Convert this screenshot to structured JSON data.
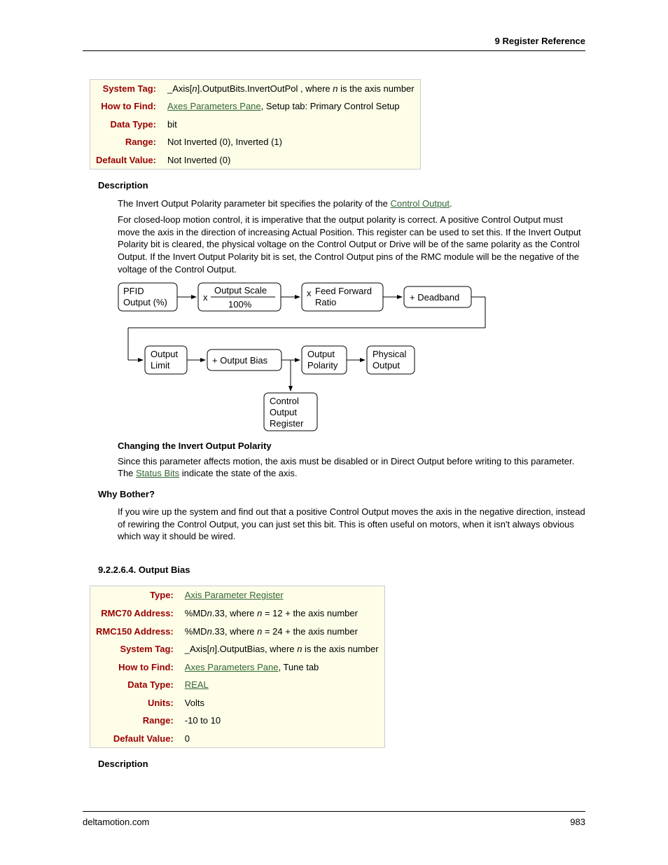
{
  "header": {
    "chapter": "9  Register Reference"
  },
  "table1": {
    "rows": [
      {
        "label": "System Tag:",
        "value_html": "_Axis[<span class='italic'>n</span>].OutputBits.InvertOutPol , where <span class='italic'>n</span> is the axis number"
      },
      {
        "label": "How to Find:",
        "value_html": "<a class='doclink' href='#'>Axes Parameters Pane</a>, Setup tab: Primary Control Setup"
      },
      {
        "label": "Data Type:",
        "value_html": "bit"
      },
      {
        "label": "Range:",
        "value_html": "Not Inverted (0), Inverted (1)"
      },
      {
        "label": "Default Value:",
        "value_html": "Not Inverted (0)"
      }
    ]
  },
  "desc_heading": "Description",
  "p1_html": "The Invert Output Polarity parameter bit specifies the polarity of the <a class='doclink' href='#'>Control Output</a>.",
  "p2_html": "For closed-loop motion control, it is imperative that the output polarity is correct. A positive Control Output must move the axis in the direction of increasing Actual Position. This register can be used to set this. If the Invert Output Polarity bit is cleared, the physical voltage on the Control Output or Drive will be of the same polarity as the Control Output. If the Invert Output Polarity bit is set, the Control Output pins of the RMC module will be the negative of the voltage of the Control Output.",
  "diagram": {
    "box1_l1": "PFID",
    "box1_l2": "Output (%)",
    "mult1": "x",
    "frac_top": "Output Scale",
    "frac_bot": "100%",
    "mult2": "x",
    "ffr_l1": "Feed Forward",
    "ffr_l2": "Ratio",
    "dead": "+ Deadband",
    "olimit_l1": "Output",
    "olimit_l2": "Limit",
    "obias": "+ Output Bias",
    "opolar_l1": "Output",
    "opolar_l2": "Polarity",
    "phys_l1": "Physical",
    "phys_l2": "Output",
    "creg_l1": "Control",
    "creg_l2": "Output",
    "creg_l3": "Register"
  },
  "changing_h": "Changing the Invert Output Polarity",
  "changing_p_html": "Since this parameter affects motion, the axis must be disabled or in Direct Output before writing to this parameter. The <a class='doclink' href='#'>Status Bits</a> indicate the state of the axis.",
  "why_h": "Why Bother?",
  "why_p": "If you wire up the system and find out that a positive Control Output moves the axis in the negative direction, instead of rewiring the Control Output, you can just set this bit. This is often useful on motors, when it isn't always obvious which way it should be wired.",
  "section_num": "9.2.2.6.4. Output Bias",
  "table2": {
    "rows": [
      {
        "label": "Type:",
        "value_html": "<a class='doclink' href='#'>Axis Parameter Register</a>"
      },
      {
        "label": "RMC70 Address:",
        "value_html": "%MD<span class='italic'>n</span>.33, where <span class='italic'>n</span> = 12 + the axis number"
      },
      {
        "label": "RMC150 Address:",
        "value_html": "%MD<span class='italic'>n</span>.33, where <span class='italic'>n</span> = 24 + the axis number"
      },
      {
        "label": "System Tag:",
        "value_html": "_Axis[<span class='italic'>n</span>].OutputBias, where <span class='italic'>n</span> is the axis number"
      },
      {
        "label": "How to Find:",
        "value_html": "<a class='doclink' href='#'>Axes Parameters Pane</a>, Tune tab"
      },
      {
        "label": "Data Type:",
        "value_html": "<a class='doclink' href='#'>REAL</a>"
      },
      {
        "label": "Units:",
        "value_html": "Volts"
      },
      {
        "label": "Range:",
        "value_html": "-10 to 10"
      },
      {
        "label": "Default Value:",
        "value_html": "0"
      }
    ]
  },
  "desc_heading2": "Description",
  "footer": {
    "left": "deltamotion.com",
    "right": "983"
  }
}
